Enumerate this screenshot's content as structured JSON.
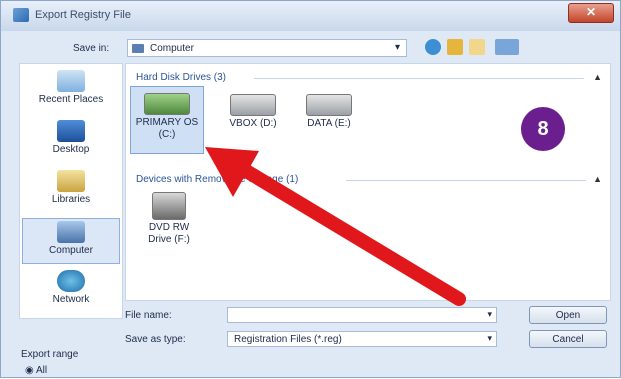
{
  "window": {
    "title": "Export Registry File",
    "close_label": "✕"
  },
  "save_in": {
    "label": "Save in:",
    "value": "Computer"
  },
  "sidebar": {
    "items": [
      {
        "label": "Recent Places"
      },
      {
        "label": "Desktop"
      },
      {
        "label": "Libraries"
      },
      {
        "label": "Computer"
      },
      {
        "label": "Network"
      }
    ]
  },
  "groups": {
    "hard_disks": {
      "header": "Hard Disk Drives (3)",
      "drives": [
        {
          "line1": "PRIMARY OS",
          "line2": "(C:)"
        },
        {
          "line1": "VBOX (D:)",
          "line2": ""
        },
        {
          "line1": "DATA (E:)",
          "line2": ""
        }
      ]
    },
    "removable": {
      "header": "Devices with Removable Storage (1)",
      "drives": [
        {
          "line1": "DVD RW",
          "line2": "Drive (F:)"
        }
      ]
    }
  },
  "badge": {
    "text": "8"
  },
  "file_name": {
    "label": "File name:",
    "value": ""
  },
  "save_as_type": {
    "label": "Save as type:",
    "value": "Registration Files (*.reg)"
  },
  "buttons": {
    "open": "Open",
    "cancel": "Cancel"
  },
  "export_range": {
    "label": "Export range",
    "option_all": "All"
  },
  "colors": {
    "arrow": "#e0181b",
    "badge": "#6b1f8f",
    "accent": "#2a5599"
  }
}
